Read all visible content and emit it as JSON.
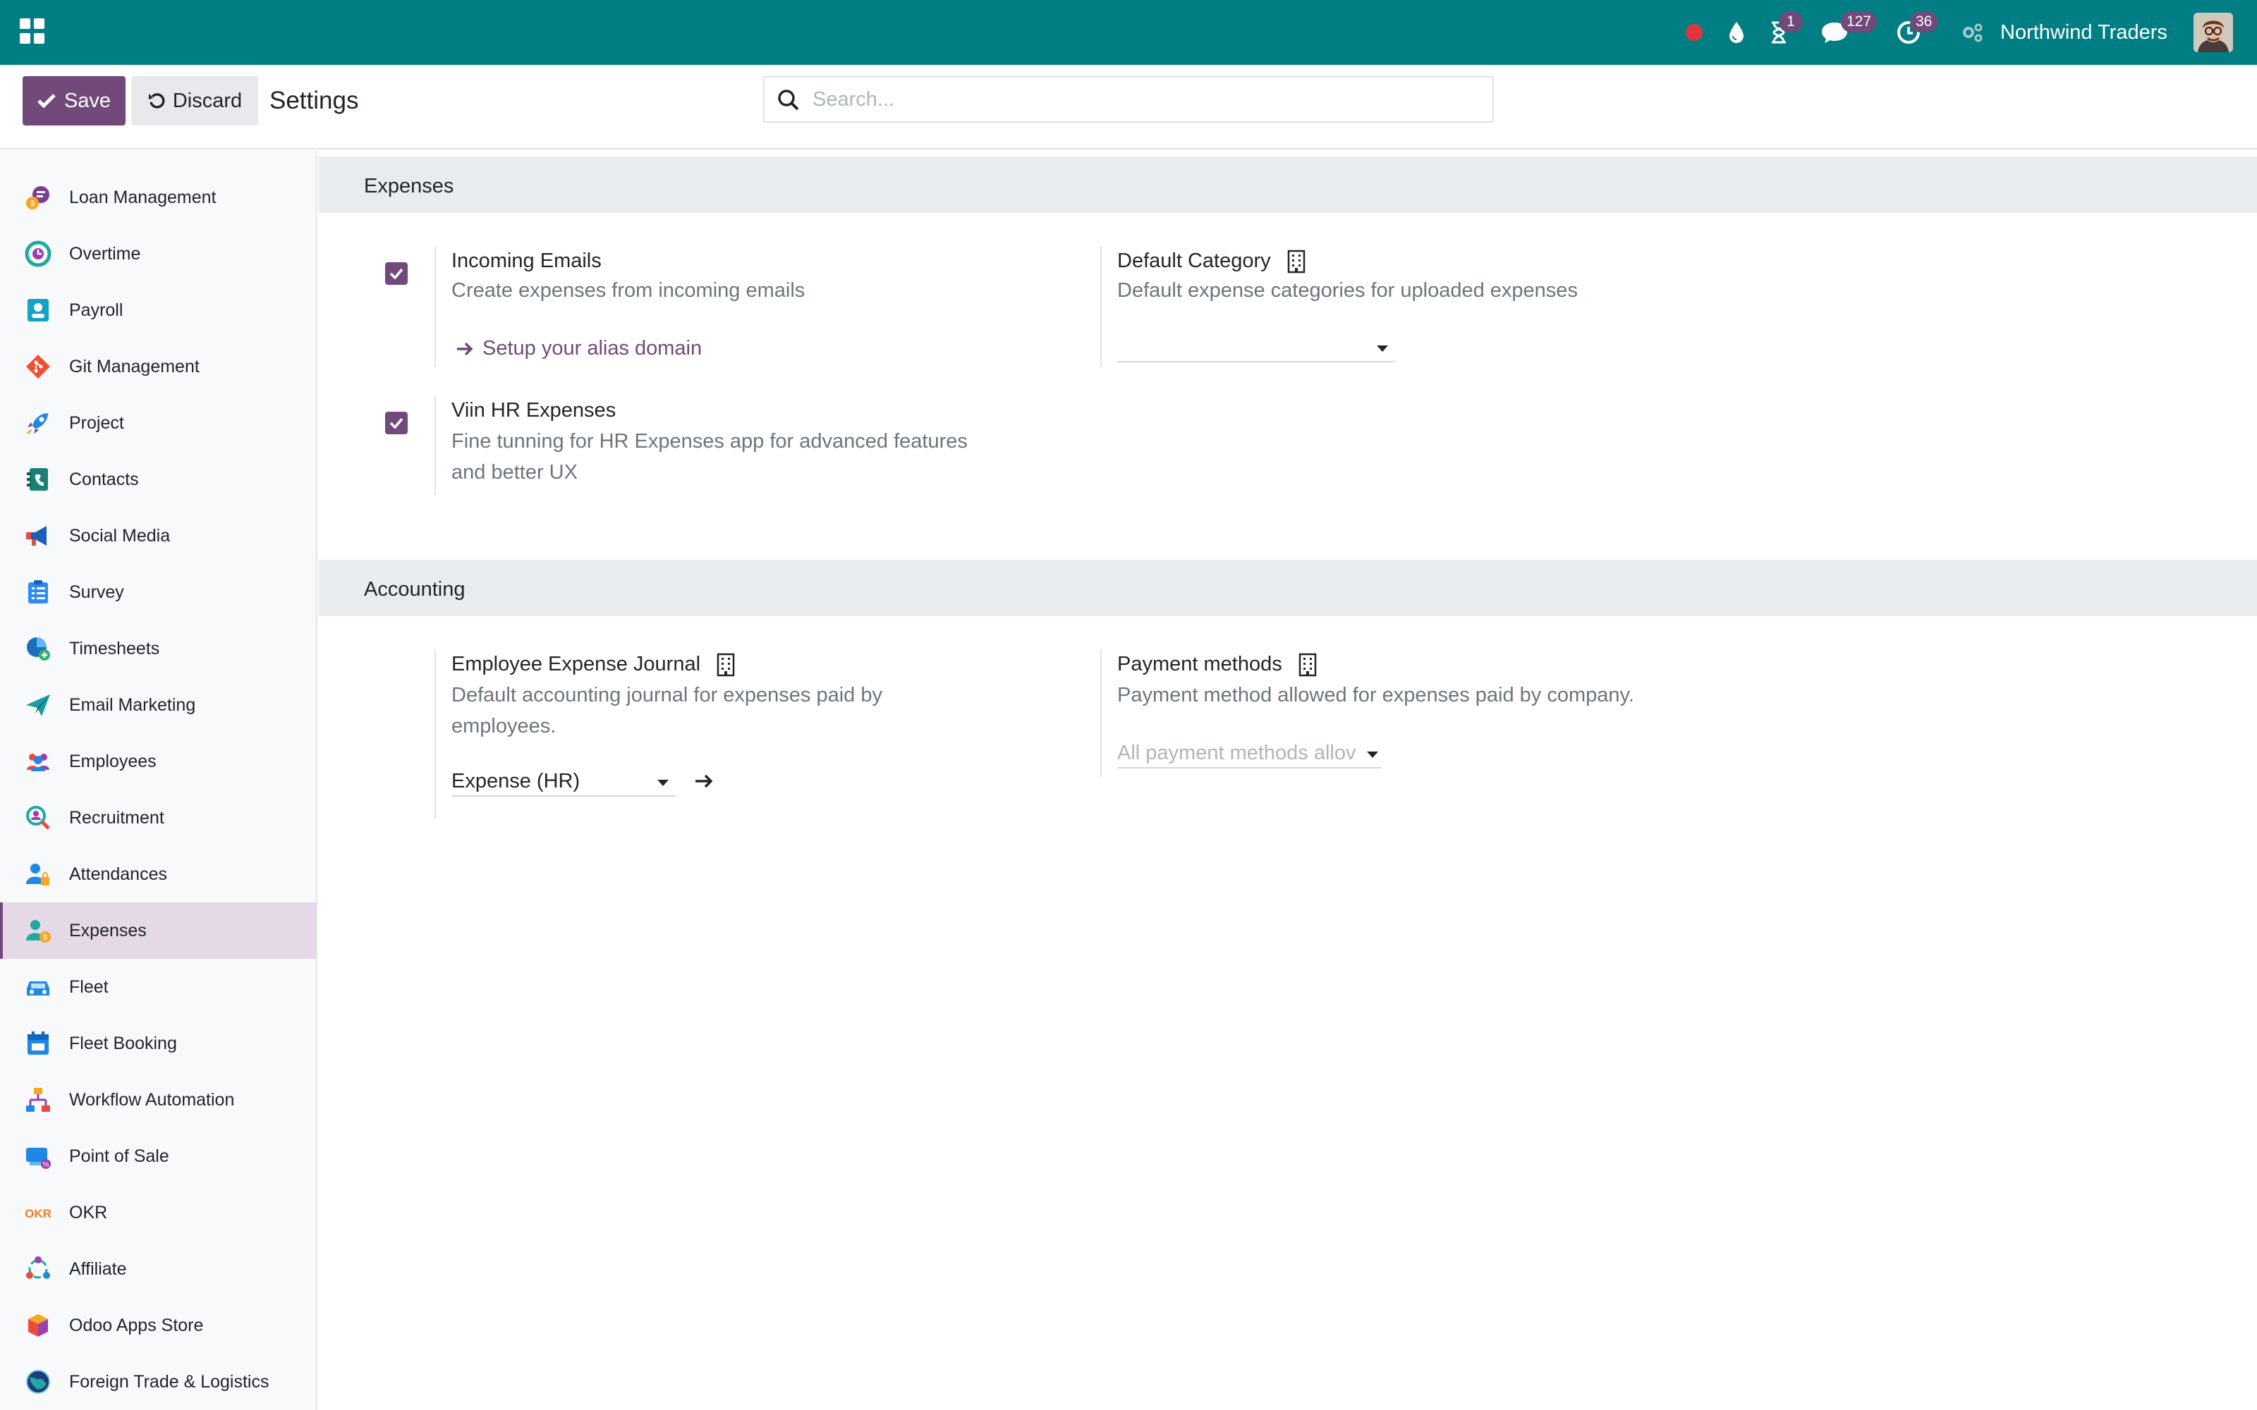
{
  "navbar": {
    "company": "Northwind Traders",
    "activity_count": "1",
    "messages_count": "127",
    "clock_count": "36"
  },
  "control_panel": {
    "save_label": "Save",
    "discard_label": "Discard",
    "title": "Settings",
    "search_placeholder": "Search..."
  },
  "sidebar": {
    "items": [
      {
        "label": "Loan Management",
        "icon": "loan-icon"
      },
      {
        "label": "Overtime",
        "icon": "overtime-icon"
      },
      {
        "label": "Payroll",
        "icon": "payroll-icon"
      },
      {
        "label": "Git Management",
        "icon": "git-icon"
      },
      {
        "label": "Project",
        "icon": "rocket-icon"
      },
      {
        "label": "Contacts",
        "icon": "contacts-icon"
      },
      {
        "label": "Social Media",
        "icon": "megaphone-icon"
      },
      {
        "label": "Survey",
        "icon": "survey-icon"
      },
      {
        "label": "Timesheets",
        "icon": "timesheets-icon"
      },
      {
        "label": "Email Marketing",
        "icon": "paper-plane-icon"
      },
      {
        "label": "Employees",
        "icon": "employees-icon"
      },
      {
        "label": "Recruitment",
        "icon": "recruitment-icon"
      },
      {
        "label": "Attendances",
        "icon": "attendances-icon"
      },
      {
        "label": "Expenses",
        "icon": "expenses-icon"
      },
      {
        "label": "Fleet",
        "icon": "car-icon"
      },
      {
        "label": "Fleet Booking",
        "icon": "calendar-icon"
      },
      {
        "label": "Workflow Automation",
        "icon": "workflow-icon"
      },
      {
        "label": "Point of Sale",
        "icon": "pos-icon"
      },
      {
        "label": "OKR",
        "icon": "okr-icon"
      },
      {
        "label": "Affiliate",
        "icon": "affiliate-icon"
      },
      {
        "label": "Odoo Apps Store",
        "icon": "apps-store-icon"
      },
      {
        "label": "Foreign Trade & Logistics",
        "icon": "globe-icon"
      }
    ],
    "active": "Expenses"
  },
  "sections": {
    "expenses": {
      "title": "Expenses",
      "incoming_emails": {
        "title": "Incoming Emails",
        "desc": "Create expenses from incoming emails",
        "checked": true,
        "link": "Setup your alias domain"
      },
      "default_category": {
        "title": "Default Category",
        "desc": "Default expense categories for uploaded expenses",
        "value": ""
      },
      "viin_hr": {
        "title": "Viin HR Expenses",
        "desc_line1": "Fine tunning for HR Expenses app for advanced features",
        "desc_line2": "and better UX",
        "checked": true
      }
    },
    "accounting": {
      "title": "Accounting",
      "journal": {
        "title": "Employee Expense Journal",
        "desc_line1": "Default accounting journal for expenses paid by",
        "desc_line2": "employees.",
        "value": "Expense (HR)"
      },
      "payment_methods": {
        "title": "Payment methods",
        "desc": "Payment method allowed for expenses paid by company.",
        "placeholder": "All payment methods allov"
      }
    }
  },
  "colors": {
    "navbar": "#017e84",
    "primary": "#71497a",
    "section_bg": "#e9ecef",
    "sidebar_active": "#e5d8e7"
  }
}
